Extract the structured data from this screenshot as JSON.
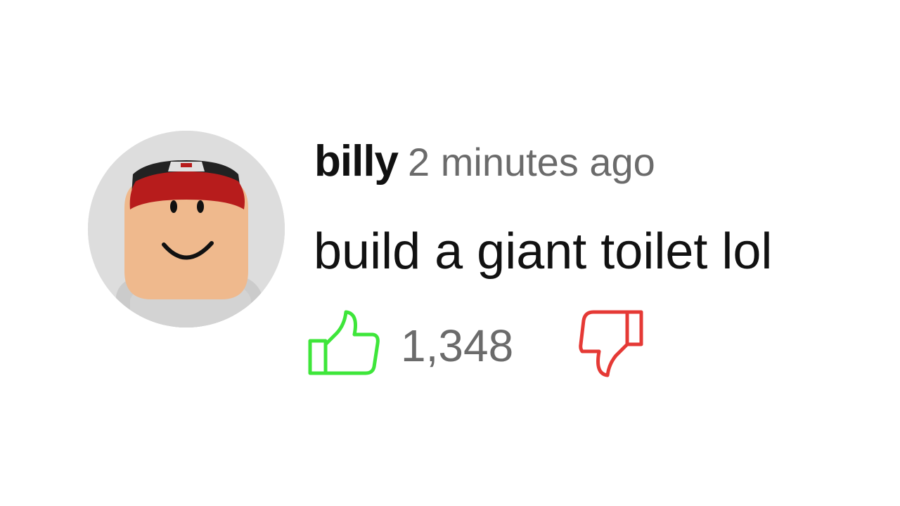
{
  "comment": {
    "author": "billy",
    "timestamp": "2 minutes ago",
    "text": "build a giant toilet lol",
    "like_count": "1,348",
    "avatar_icon": "blocky-avatar-red-cap-smiley-icon",
    "like_icon": "thumbs-up-icon",
    "dislike_icon": "thumbs-down-icon"
  },
  "colors": {
    "author": "#111111",
    "meta_text": "#6b6b6b",
    "like_icon": "#3ee63a",
    "dislike_icon": "#e53935",
    "avatar_background": "#dddddd"
  }
}
